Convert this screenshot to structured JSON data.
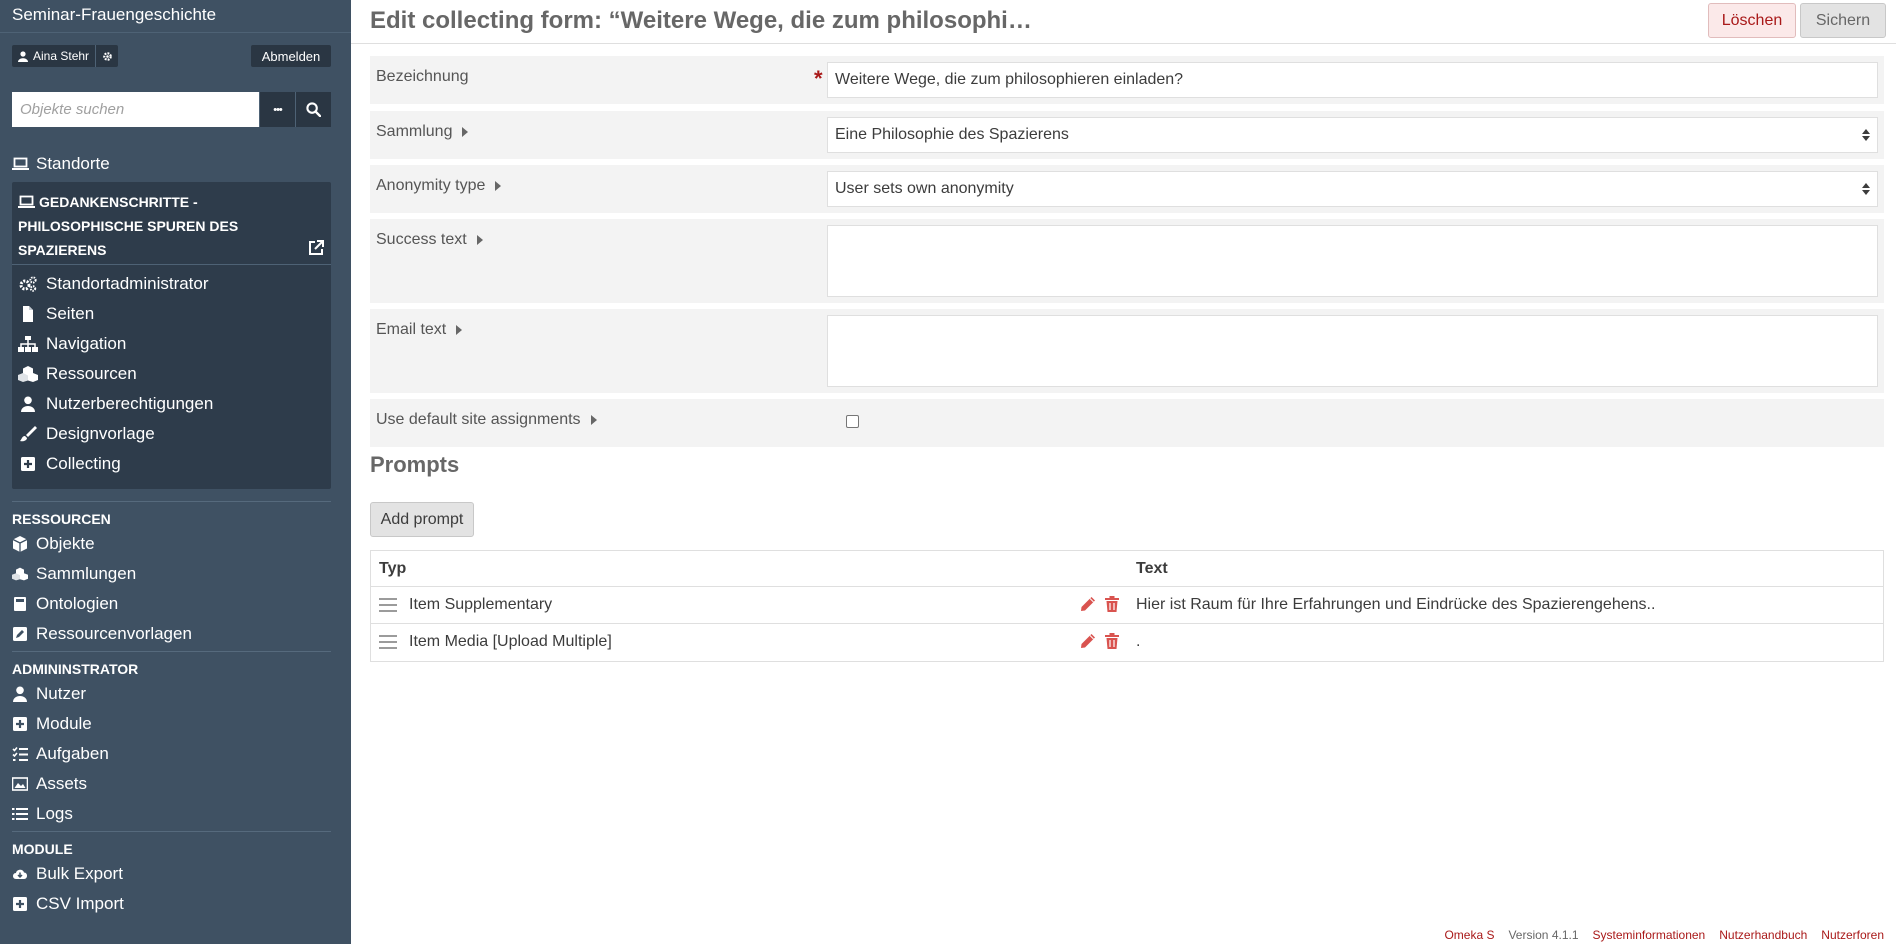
{
  "app": {
    "site_title": "Seminar-Frauengeschichte",
    "user_name": "Aina Stehr",
    "logout_label": "Abmelden",
    "search_placeholder": "Objekte suchen",
    "search_more": "•••",
    "sites_label": "Standorte"
  },
  "site": {
    "name": "Gedankenschritte - Philosophische Spuren des Spazierens",
    "items": [
      {
        "label": "Standortadministrator",
        "icon": "cogs-icon"
      },
      {
        "label": "Seiten",
        "icon": "file-icon"
      },
      {
        "label": "Navigation",
        "icon": "sitemap-icon"
      },
      {
        "label": "Ressourcen",
        "icon": "cubes-icon"
      },
      {
        "label": "Nutzerberechtigungen",
        "icon": "user-icon"
      },
      {
        "label": "Designvorlage",
        "icon": "paint-brush-icon"
      },
      {
        "label": "Collecting",
        "icon": "plus-square-icon"
      }
    ]
  },
  "sections": {
    "resources": {
      "heading": "Ressourcen",
      "items": [
        {
          "label": "Objekte",
          "icon": "cube-icon"
        },
        {
          "label": "Sammlungen",
          "icon": "cubes-icon"
        },
        {
          "label": "Ontologien",
          "icon": "book-icon"
        },
        {
          "label": "Ressourcenvorlagen",
          "icon": "edit-square-icon"
        }
      ]
    },
    "admin": {
      "heading": "Admininstrator",
      "items": [
        {
          "label": "Nutzer",
          "icon": "user-icon"
        },
        {
          "label": "Module",
          "icon": "plus-square-icon"
        },
        {
          "label": "Aufgaben",
          "icon": "tasks-icon"
        },
        {
          "label": "Assets",
          "icon": "image-icon"
        },
        {
          "label": "Logs",
          "icon": "list-icon"
        }
      ]
    },
    "modules": {
      "heading": "Module",
      "items": [
        {
          "label": "Bulk Export",
          "icon": "cloud-download-icon"
        },
        {
          "label": "CSV Import",
          "icon": "plus-square-icon"
        }
      ]
    }
  },
  "header": {
    "title": "Edit collecting form: “Weitere Wege, die zum philosophi…",
    "delete_label": "Löschen",
    "save_label": "Sichern"
  },
  "form": {
    "bezeichnung": {
      "label": "Bezeichnung",
      "value": "Weitere Wege, die zum philosophieren einladen?"
    },
    "sammlung": {
      "label": "Sammlung",
      "value": "Eine Philosophie des Spazierens"
    },
    "anonymity": {
      "label": "Anonymity type",
      "value": "User sets own anonymity"
    },
    "success": {
      "label": "Success text",
      "value": ""
    },
    "email": {
      "label": "Email text",
      "value": ""
    },
    "default_sites": {
      "label": "Use default site assignments",
      "checked": false
    }
  },
  "prompts": {
    "heading": "Prompts",
    "add_label": "Add prompt",
    "col_type": "Typ",
    "col_text": "Text",
    "rows": [
      {
        "type": "Item Supplementary",
        "text": "Hier ist Raum für Ihre Erfahrungen und Eindrücke des Spazierengehens.."
      },
      {
        "type": "Item Media [Upload Multiple]",
        "text": "."
      }
    ]
  },
  "footer": {
    "brand": "Omeka S",
    "version": "Version 4.1.1",
    "sysinfo": "Systeminformationen",
    "manual": "Nutzerhandbuch",
    "forums": "Nutzerforen"
  },
  "colors": {
    "sidebar": "#3f5163",
    "panel": "#2e3c4b",
    "accent_red": "#a91919"
  }
}
